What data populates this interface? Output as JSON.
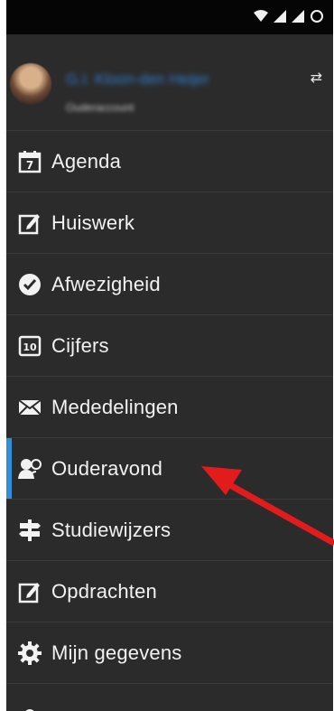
{
  "status_icons": [
    "wifi-icon",
    "signal-icon",
    "signal-icon-2",
    "loading-circle-icon"
  ],
  "user": {
    "name": "G.I. Kloon-den Heijer",
    "subtitle": "Ouderaccount"
  },
  "menu": {
    "items": [
      {
        "label": "Agenda",
        "icon": "calendar-icon"
      },
      {
        "label": "Huiswerk",
        "icon": "edit-icon"
      },
      {
        "label": "Afwezigheid",
        "icon": "check-circle-icon"
      },
      {
        "label": "Cijfers",
        "icon": "grades-10-icon"
      },
      {
        "label": "Mededelingen",
        "icon": "envelope-icon"
      },
      {
        "label": "Ouderavond",
        "icon": "parent-teacher-icon",
        "active": true
      },
      {
        "label": "Studiewijzers",
        "icon": "signpost-icon"
      },
      {
        "label": "Opdrachten",
        "icon": "edit-icon"
      },
      {
        "label": "Mijn gegevens",
        "icon": "gear-icon"
      }
    ]
  },
  "colors": {
    "accent": "#2f90d8",
    "annotation_arrow": "#e21c1c",
    "background": "#2b2b2b"
  }
}
